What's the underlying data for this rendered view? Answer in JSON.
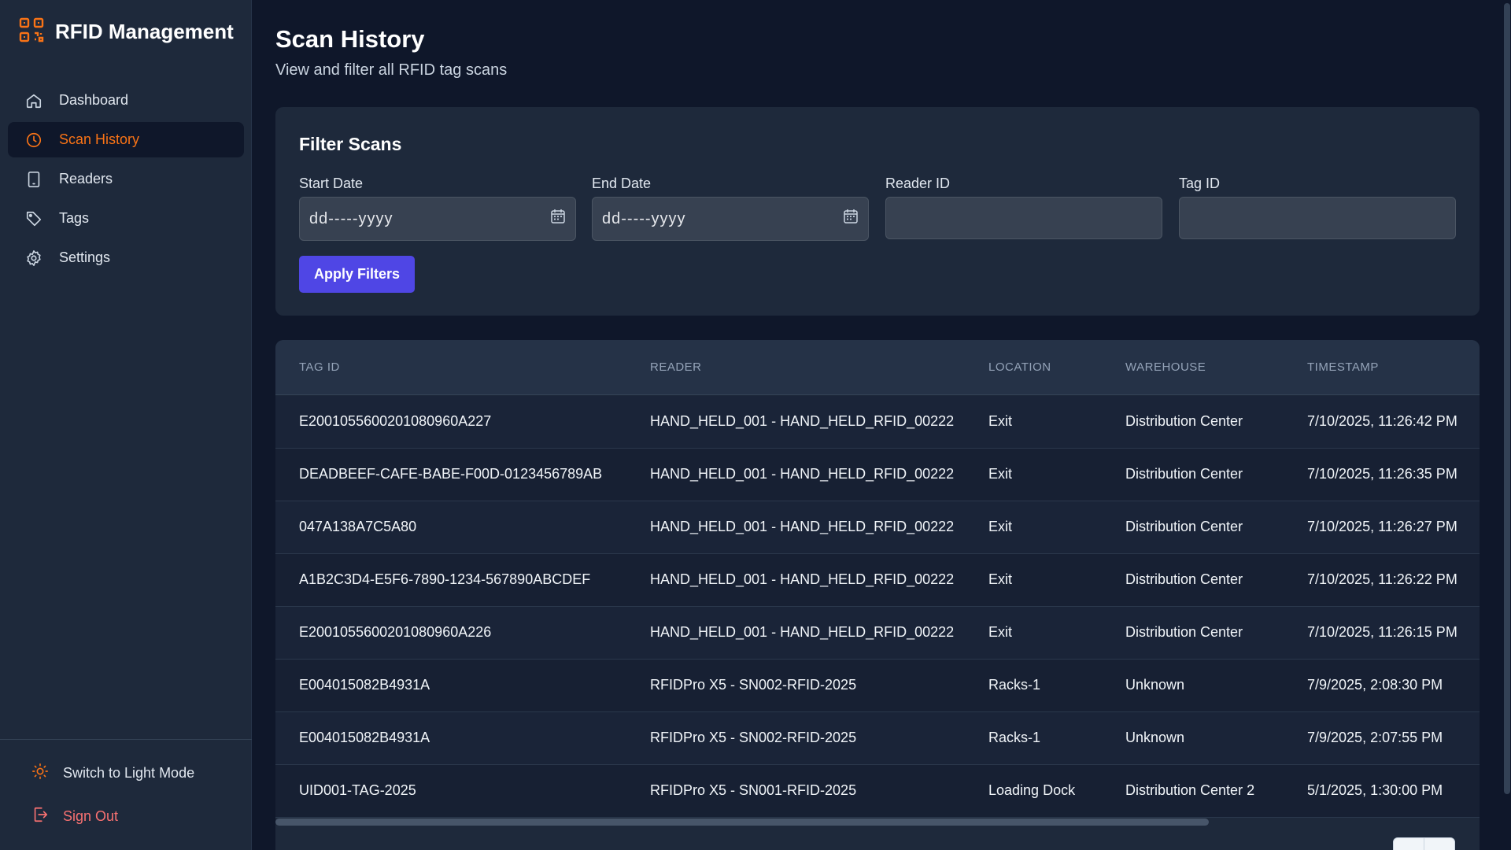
{
  "app": {
    "brand_title": "RFID Management",
    "accent_color": "#f97316",
    "primary_color": "#4f46e5",
    "logo_icon": "qr-code-icon"
  },
  "sidebar": {
    "items": [
      {
        "label": "Dashboard",
        "icon": "home-icon",
        "active": false
      },
      {
        "label": "Scan History",
        "icon": "clock-icon",
        "active": true
      },
      {
        "label": "Readers",
        "icon": "tablet-icon",
        "active": false
      },
      {
        "label": "Tags",
        "icon": "tag-icon",
        "active": false
      },
      {
        "label": "Settings",
        "icon": "gear-icon",
        "active": false
      }
    ],
    "theme_toggle_label": "Switch to Light Mode",
    "sign_out_label": "Sign Out"
  },
  "page": {
    "title": "Scan History",
    "subtitle": "View and filter all RFID tag scans"
  },
  "filters": {
    "title": "Filter Scans",
    "start_date": {
      "label": "Start Date",
      "value": "dd-----yyyy"
    },
    "end_date": {
      "label": "End Date",
      "value": "dd-----yyyy"
    },
    "reader_id": {
      "label": "Reader ID",
      "value": ""
    },
    "tag_id": {
      "label": "Tag ID",
      "value": ""
    },
    "apply_label": "Apply Filters"
  },
  "table": {
    "headers": [
      "TAG ID",
      "READER",
      "LOCATION",
      "WAREHOUSE",
      "TIMESTAMP"
    ],
    "rows": [
      [
        "E2001055600201080960A227",
        "HAND_HELD_001 - HAND_HELD_RFID_00222",
        "Exit",
        "Distribution Center",
        "7/10/2025, 11:26:42 PM"
      ],
      [
        "DEADBEEF-CAFE-BABE-F00D-0123456789AB",
        "HAND_HELD_001 - HAND_HELD_RFID_00222",
        "Exit",
        "Distribution Center",
        "7/10/2025, 11:26:35 PM"
      ],
      [
        "047A138A7C5A80",
        "HAND_HELD_001 - HAND_HELD_RFID_00222",
        "Exit",
        "Distribution Center",
        "7/10/2025, 11:26:27 PM"
      ],
      [
        "A1B2C3D4-E5F6-7890-1234-567890ABCDEF",
        "HAND_HELD_001 - HAND_HELD_RFID_00222",
        "Exit",
        "Distribution Center",
        "7/10/2025, 11:26:22 PM"
      ],
      [
        "E2001055600201080960A226",
        "HAND_HELD_001 - HAND_HELD_RFID_00222",
        "Exit",
        "Distribution Center",
        "7/10/2025, 11:26:15 PM"
      ],
      [
        "E004015082B4931A",
        "RFIDPro X5 - SN002-RFID-2025",
        "Racks-1",
        "Unknown",
        "7/9/2025, 2:08:30 PM"
      ],
      [
        "E004015082B4931A",
        "RFIDPro X5 - SN002-RFID-2025",
        "Racks-1",
        "Unknown",
        "7/9/2025, 2:07:55 PM"
      ],
      [
        "UID001-TAG-2025",
        "RFIDPro X5 - SN001-RFID-2025",
        "Loading Dock",
        "Distribution Center 2",
        "5/1/2025, 1:30:00 PM"
      ]
    ]
  }
}
